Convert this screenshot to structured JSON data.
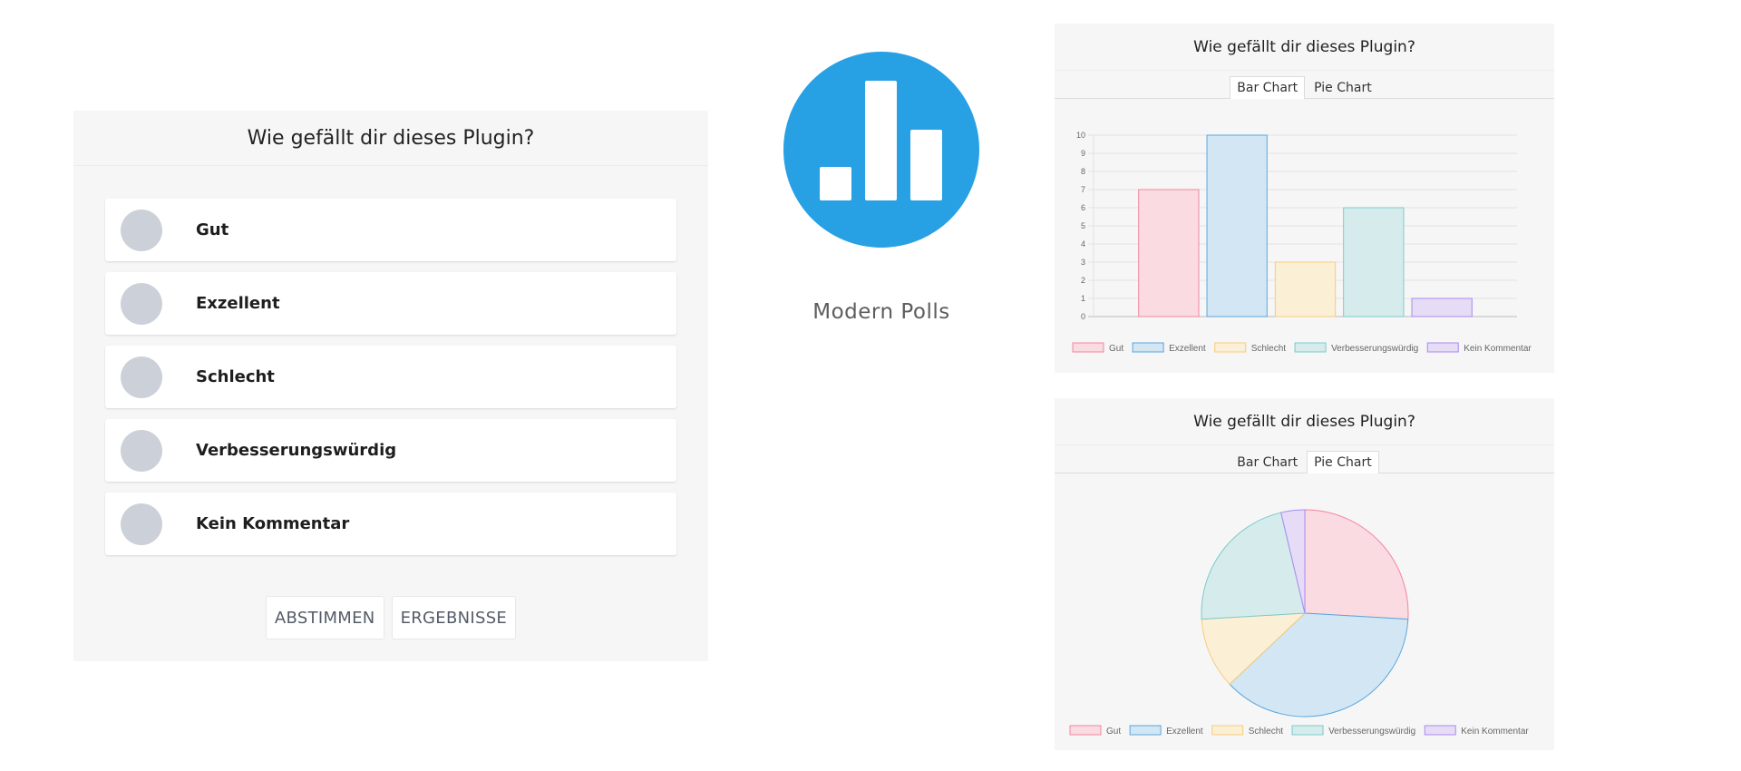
{
  "poll": {
    "question": "Wie gefällt dir dieses Plugin?",
    "options": [
      {
        "label": "Gut"
      },
      {
        "label": "Exzellent"
      },
      {
        "label": "Schlecht"
      },
      {
        "label": "Verbesserungswürdig"
      },
      {
        "label": "Kein Kommentar"
      }
    ],
    "vote_button": "ABSTIMMEN",
    "results_button": "ERGEBNISSE"
  },
  "logo": {
    "name": "Modern Polls",
    "color": "#27a0e4"
  },
  "bar_card": {
    "title": "Wie gefällt dir dieses Plugin?",
    "tab_bar": "Bar Chart",
    "tab_pie": "Pie Chart",
    "active_tab": "bar"
  },
  "pie_card": {
    "title": "Wie gefällt dir dieses Plugin?",
    "tab_bar": "Bar Chart",
    "tab_pie": "Pie Chart",
    "active_tab": "pie"
  },
  "chart_data": [
    {
      "type": "bar",
      "title": "Wie gefällt dir dieses Plugin?",
      "categories": [
        "Gut",
        "Exzellent",
        "Schlecht",
        "Verbesserungswürdig",
        "Kein Kommentar"
      ],
      "values": [
        7,
        10,
        3,
        6,
        1
      ],
      "ylim": [
        0,
        10
      ],
      "yticks": [
        0,
        1,
        2,
        3,
        4,
        5,
        6,
        7,
        8,
        9,
        10
      ],
      "grid": true,
      "legend": "bottom",
      "fill_colors": [
        "#f9dbe1",
        "#d2e6f4",
        "#fbefd6",
        "#d6ecec",
        "#e6dcf6"
      ],
      "border_colors": [
        "#f3859f",
        "#5aa7de",
        "#f8cc78",
        "#7ccaca",
        "#a98af2"
      ]
    },
    {
      "type": "pie",
      "title": "Wie gefällt dir dieses Plugin?",
      "categories": [
        "Gut",
        "Exzellent",
        "Schlecht",
        "Verbesserungswürdig",
        "Kein Kommentar"
      ],
      "values": [
        7,
        10,
        3,
        6,
        1
      ],
      "legend": "bottom",
      "fill_colors": [
        "#f9dbe1",
        "#d2e6f4",
        "#fbefd6",
        "#d6ecec",
        "#e6dcf6"
      ],
      "border_colors": [
        "#f3859f",
        "#5aa7de",
        "#f8cc78",
        "#7ccaca",
        "#a98af2"
      ]
    }
  ]
}
